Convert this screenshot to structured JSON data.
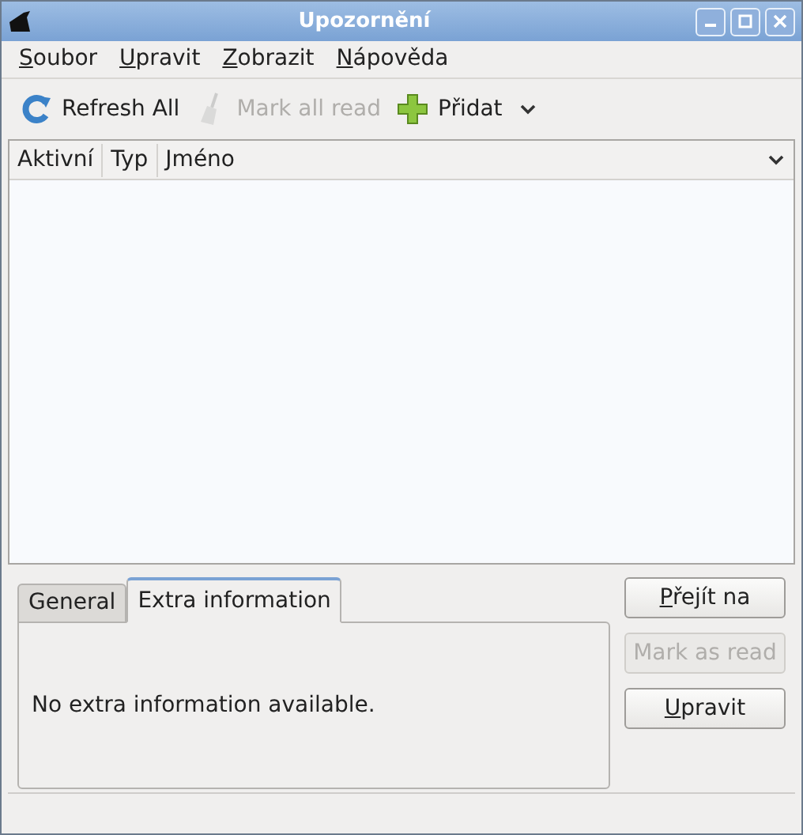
{
  "window": {
    "title": "Upozornění"
  },
  "menu": [
    {
      "label": "Soubor",
      "mnemonic": true
    },
    {
      "label": "Upravit",
      "mnemonic": true
    },
    {
      "label": "Zobrazit",
      "mnemonic": true
    },
    {
      "label": "Nápověda",
      "mnemonic": true
    }
  ],
  "toolbar": [
    {
      "kind": "refresh",
      "label": "Refresh All",
      "disabled": false
    },
    {
      "kind": "broom",
      "label": "Mark all read",
      "disabled": true
    },
    {
      "kind": "add",
      "label": "Přidat",
      "disabled": false
    }
  ],
  "table": {
    "columns": [
      "Aktivní",
      "Typ",
      "Jméno"
    ]
  },
  "tabs": [
    {
      "label": "General",
      "selected": false
    },
    {
      "label": "Extra information",
      "selected": true
    }
  ],
  "tab_content": "No extra information available.",
  "buttons": [
    {
      "label": "Přejít na",
      "mnemonic": true,
      "disabled": false
    },
    {
      "label": "Mark as read",
      "mnemonic": false,
      "disabled": true
    },
    {
      "label": "Upravit",
      "mnemonic": true,
      "disabled": false
    }
  ]
}
